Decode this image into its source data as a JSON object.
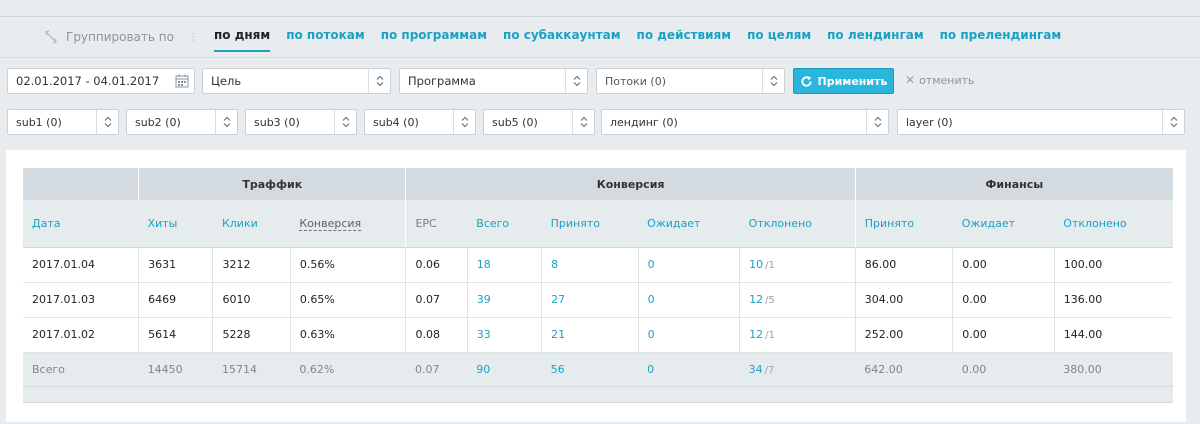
{
  "group_by": {
    "label": "Группировать по",
    "tabs": [
      {
        "label": "по дням",
        "active": true
      },
      {
        "label": "по потокам"
      },
      {
        "label": "по программам"
      },
      {
        "label": "по субаккаунтам"
      },
      {
        "label": "по действиям"
      },
      {
        "label": "по целям"
      },
      {
        "label": "по лендингам"
      },
      {
        "label": "по прелендингам"
      }
    ]
  },
  "filters": {
    "date_range": "02.01.2017 - 04.01.2017",
    "goal": "Цель",
    "program": "Программа",
    "streams": "Потоки (0)",
    "apply_label": "Применить",
    "cancel_label": "отменить",
    "sub1": "sub1 (0)",
    "sub2": "sub2 (0)",
    "sub3": "sub3 (0)",
    "sub4": "sub4 (0)",
    "sub5": "sub5 (0)",
    "landing": "лендинг (0)",
    "layer": "layer (0)"
  },
  "table": {
    "groups": {
      "traffic": "Траффик",
      "conversion": "Конверсия",
      "finance": "Финансы"
    },
    "columns": [
      "Дата",
      "Хиты",
      "Клики",
      "Конверсия",
      "EPC",
      "Всего",
      "Принято",
      "Ожидает",
      "Отклонено",
      "Принято",
      "Ожидает",
      "Отклонено"
    ],
    "rows": [
      {
        "date": "2017.01.04",
        "hits": "3631",
        "clicks": "3212",
        "cr": "0.56%",
        "epc": "0.06",
        "total": "18",
        "accepted": "8",
        "pending": "0",
        "rejected": "10",
        "rejected_extra": "/1",
        "f_accepted": "86.00",
        "f_pending": "0.00",
        "f_rejected": "100.00"
      },
      {
        "date": "2017.01.03",
        "hits": "6469",
        "clicks": "6010",
        "cr": "0.65%",
        "epc": "0.07",
        "total": "39",
        "accepted": "27",
        "pending": "0",
        "rejected": "12",
        "rejected_extra": "/5",
        "f_accepted": "304.00",
        "f_pending": "0.00",
        "f_rejected": "136.00"
      },
      {
        "date": "2017.01.02",
        "hits": "5614",
        "clicks": "5228",
        "cr": "0.63%",
        "epc": "0.08",
        "total": "33",
        "accepted": "21",
        "pending": "0",
        "rejected": "12",
        "rejected_extra": "/1",
        "f_accepted": "252.00",
        "f_pending": "0.00",
        "f_rejected": "144.00"
      }
    ],
    "totals": {
      "label": "Всего",
      "hits": "14450",
      "clicks": "15714",
      "cr": "0.62%",
      "epc": "0.07",
      "total": "90",
      "accepted": "56",
      "pending": "0",
      "rejected": "34",
      "rejected_extra": "/7",
      "f_accepted": "642.00",
      "f_pending": "0.00",
      "f_rejected": "380.00"
    }
  },
  "icons": {
    "group": "ungroup-icon",
    "calendar": "calendar-icon",
    "chevron": "updown-chevron-icon",
    "refresh": "refresh-icon",
    "close": "close-icon"
  },
  "colors": {
    "accent": "#1aa2c5",
    "button": "#2ab6dc"
  }
}
